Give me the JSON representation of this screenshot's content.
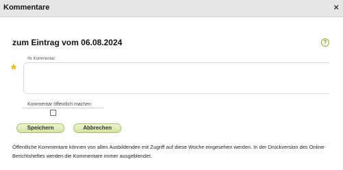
{
  "dialog": {
    "title": "Kommentare",
    "close_symbol": "×"
  },
  "entry": {
    "heading": "zum Eintrag vom 06.08.2024",
    "help_symbol": "?"
  },
  "comment": {
    "label": "Ihr Kommentar:",
    "value": "",
    "required_symbol": "*"
  },
  "public": {
    "label": "Kommentar öffentlich machen",
    "checked": false
  },
  "buttons": {
    "save_label": "Speichern",
    "cancel_label": "Abbrechen"
  },
  "info": {
    "text": "Öffentliche Kommentare können von allen Ausbildenden mit Zugriff auf diese Woche eingesehen werden. In der Druckversion des Online-Berichtsheftes werden die Kommentare immer ausgeblendet."
  },
  "colors": {
    "titlebar_bg": "#e7e7e7",
    "button_bg": "#d3e4a2",
    "required_star": "#f0b400",
    "help_accent": "#8ab22c"
  },
  "icons": [
    "close-icon",
    "help-icon",
    "required-star-icon"
  ]
}
